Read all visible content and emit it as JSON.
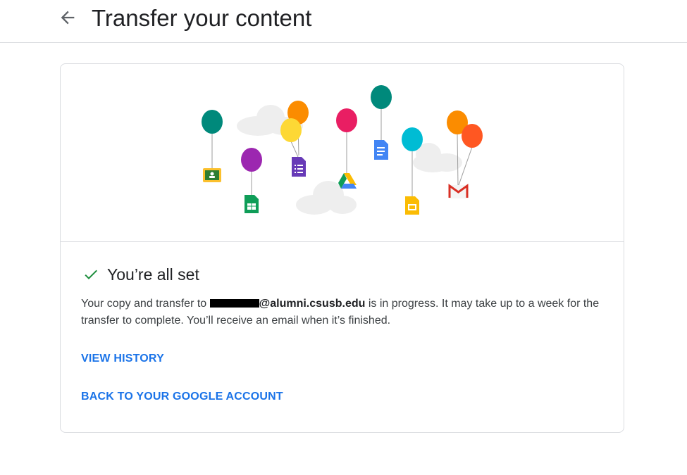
{
  "header": {
    "title": "Transfer your content",
    "back_icon": "arrow-back-icon"
  },
  "illustration": {
    "icons": [
      "classroom-icon",
      "sheets-icon",
      "forms-icon",
      "drive-icon",
      "docs-icon",
      "slides-icon",
      "gmail-icon"
    ],
    "colors": {
      "teal": "#00897b",
      "purple": "#9c27b0",
      "orange": "#fb8c00",
      "yellow": "#fdd835",
      "pink": "#e91e63",
      "cyan": "#00bcd4",
      "red_orange": "#ff5722",
      "cloud": "#eeeeee"
    }
  },
  "status": {
    "icon": "check-icon",
    "title": "You’re all set",
    "check_color": "#1e8e3e"
  },
  "message": {
    "before": "Your copy and transfer to ",
    "email_domain": "@alumni.csusb.edu",
    "after": " is in progress. It may take up to a week for the transfer to complete. You’ll receive an email when it’s finished."
  },
  "links": {
    "view_history": "VIEW HISTORY",
    "back_to_account": "BACK TO YOUR GOOGLE ACCOUNT",
    "color": "#1a73e8"
  }
}
